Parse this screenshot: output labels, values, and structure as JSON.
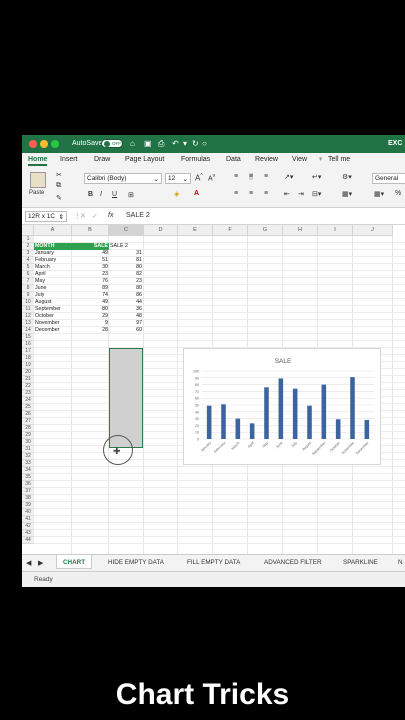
{
  "window": {
    "autosave_label": "AutoSave",
    "autosave_state": "OFF",
    "doc_title": "EXC",
    "colors": {
      "brand": "#217346",
      "header_fill": "#2ea04e",
      "bar": "#3c64a0"
    }
  },
  "ribbon_tabs": [
    "Home",
    "Insert",
    "Draw",
    "Page Layout",
    "Formulas",
    "Data",
    "Review",
    "View",
    "Tell me"
  ],
  "ribbon": {
    "paste_label": "Paste",
    "font_name": "Calibri (Body)",
    "font_size": "12",
    "bold": "B",
    "italic": "I",
    "underline": "U",
    "number_format": "General",
    "percent": "%"
  },
  "formula_bar": {
    "name_box": "12R x 1C",
    "fx": "fx",
    "content": "SALE 2"
  },
  "columns": [
    "A",
    "B",
    "C",
    "D",
    "E",
    "F",
    "G",
    "H",
    "I",
    "J"
  ],
  "rows": [
    "1",
    "2",
    "3",
    "4",
    "5",
    "6",
    "7",
    "8",
    "9",
    "10",
    "11",
    "12",
    "13",
    "14",
    "15",
    "16",
    "17",
    "18",
    "19",
    "20",
    "21",
    "22",
    "23",
    "24",
    "25",
    "26",
    "27",
    "28",
    "29",
    "30",
    "31",
    "32",
    "33",
    "34",
    "35",
    "36",
    "37",
    "38",
    "39",
    "40",
    "41",
    "42",
    "43",
    "44"
  ],
  "table": {
    "headers": [
      "MONTH",
      "SALE",
      "SALE 2"
    ],
    "months": [
      "January",
      "February",
      "March",
      "April",
      "May",
      "June",
      "July",
      "August",
      "September",
      "October",
      "November",
      "December"
    ],
    "sale": [
      "49",
      "51",
      "30",
      "23",
      "76",
      "89",
      "74",
      "49",
      "80",
      "29",
      "9",
      "28"
    ],
    "sale2": [
      "31",
      "81",
      "80",
      "82",
      "23",
      "80",
      "86",
      "44",
      "36",
      "48",
      "97",
      "60"
    ]
  },
  "chart_data": {
    "type": "bar",
    "title": "SALE",
    "categories": [
      "January",
      "February",
      "March",
      "April",
      "May",
      "June",
      "July",
      "August",
      "September",
      "October",
      "November",
      "December"
    ],
    "values": [
      49,
      51,
      30,
      23,
      76,
      89,
      74,
      49,
      80,
      29,
      91,
      28
    ],
    "ylim": [
      0,
      100
    ],
    "yticks": [
      "0",
      "10",
      "20",
      "30",
      "40",
      "50",
      "60",
      "70",
      "80",
      "90",
      "100"
    ],
    "grid": true
  },
  "sheet_tabs": [
    "CHART",
    "HIDE EMPTY DATA",
    "FILL EMPTY DATA",
    "ADVANCED FILTER",
    "SPARKLINE",
    "N"
  ],
  "status": "Ready",
  "caption": "Chart Tricks"
}
